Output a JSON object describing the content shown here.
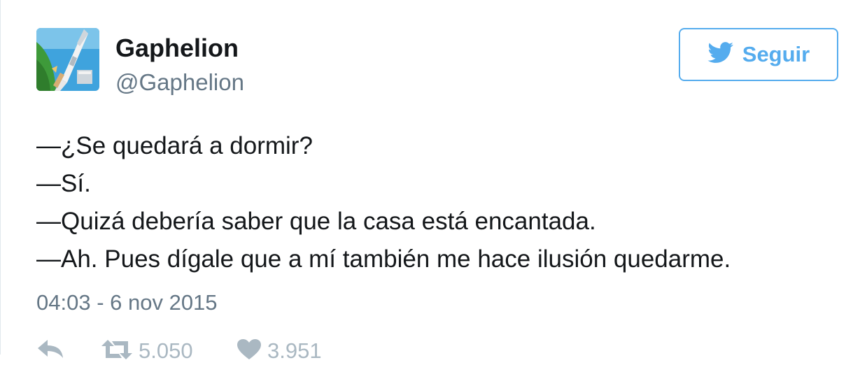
{
  "user": {
    "name": "Gaphelion",
    "handle": "@Gaphelion",
    "avatar_icon": "rocket-avatar"
  },
  "follow_button": {
    "label": "Seguir",
    "icon": "twitter-bird-icon",
    "color": "#55acee"
  },
  "tweet": {
    "lines": [
      "—¿Se quedará a dormir?",
      "—Sí.",
      "—Quizá debería saber que la casa está encantada.",
      "—Ah. Pues dígale que a mí también me hace ilusión quedarme."
    ],
    "timestamp": "04:03 - 6 nov 2015"
  },
  "actions": {
    "reply": {
      "icon": "reply-icon"
    },
    "retweet": {
      "icon": "retweet-icon",
      "count": "5.050"
    },
    "like": {
      "icon": "heart-icon",
      "count": "3.951"
    }
  },
  "colors": {
    "text": "#14171a",
    "secondary": "#657786",
    "action": "#aab8c2",
    "accent": "#55acee"
  }
}
